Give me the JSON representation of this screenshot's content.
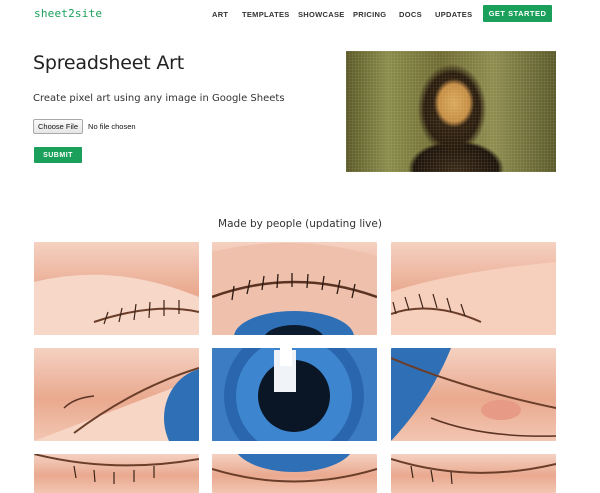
{
  "header": {
    "logo": "sheet2site",
    "nav": [
      "ART",
      "TEMPLATES",
      "SHOWCASE",
      "PRICING",
      "DOCS",
      "UPDATES"
    ],
    "cta": "GET STARTED"
  },
  "hero": {
    "title": "Spreadsheet Art",
    "subtitle": "Create pixel art using any image in Google Sheets",
    "file_button": "Choose File",
    "file_status": "No file chosen",
    "submit": "SUBMIT"
  },
  "gallery": {
    "title": "Made by people (updating live)"
  },
  "colors": {
    "accent": "#1aa05a",
    "iris": "#2f6fb6",
    "skin": "#f0c0aa"
  }
}
